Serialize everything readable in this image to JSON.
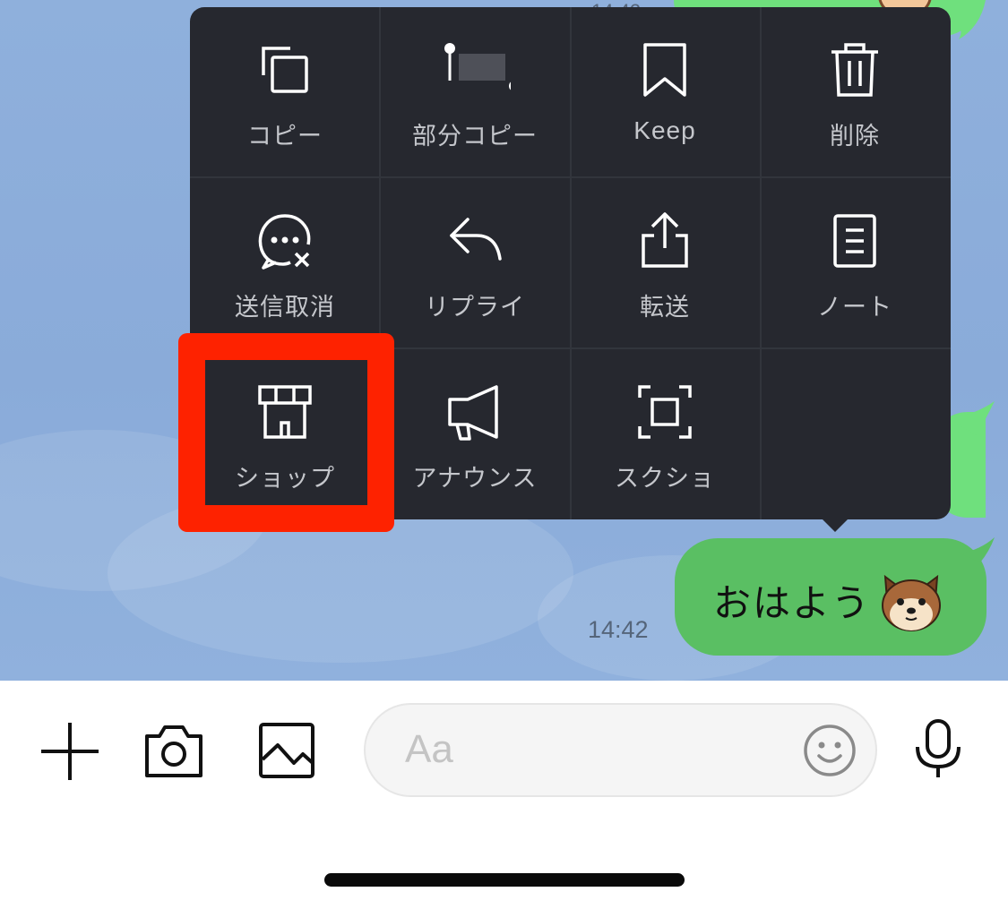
{
  "context_menu": {
    "items": [
      {
        "label": "コピー",
        "icon": "copy-icon"
      },
      {
        "label": "部分コピー",
        "icon": "partial-copy-icon"
      },
      {
        "label": "Keep",
        "icon": "bookmark-icon"
      },
      {
        "label": "削除",
        "icon": "trash-icon"
      },
      {
        "label": "送信取消",
        "icon": "unsend-icon"
      },
      {
        "label": "リプライ",
        "icon": "reply-icon"
      },
      {
        "label": "転送",
        "icon": "share-icon"
      },
      {
        "label": "ノート",
        "icon": "note-icon"
      },
      {
        "label": "ショップ",
        "icon": "shop-icon"
      },
      {
        "label": "アナウンス",
        "icon": "megaphone-icon"
      },
      {
        "label": "スクショ",
        "icon": "screenshot-icon"
      }
    ],
    "highlighted_item": "ショップ"
  },
  "message": {
    "text": "おはよう",
    "time": "14:42",
    "sticker": "shiba-dog-emoji"
  },
  "input_bar": {
    "placeholder": "Aa",
    "icons": [
      "plus-icon",
      "camera-icon",
      "image-icon",
      "emoji-icon",
      "microphone-icon"
    ]
  },
  "colors": {
    "chat_background": "#8fb0dc",
    "menu_background": "#26282f",
    "own_bubble": "#5abf63",
    "highlight_box": "#fe2200"
  }
}
